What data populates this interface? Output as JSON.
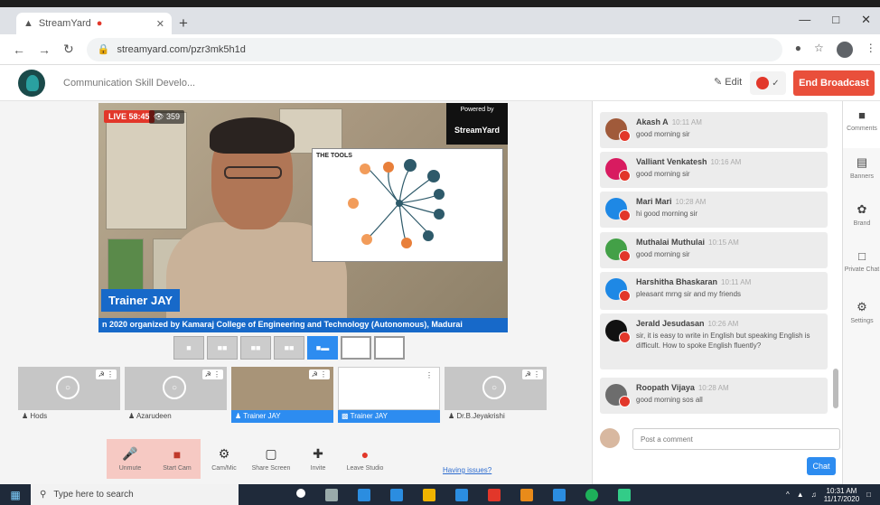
{
  "browser": {
    "tab_title": "StreamYard",
    "url": "streamyard.com/pzr3mk5h1d"
  },
  "app": {
    "title": "Communication Skill Develo...",
    "edit_label": "Edit",
    "end_broadcast_label": "End Broadcast"
  },
  "stage": {
    "live_label": "LIVE 58:45",
    "viewers": "359",
    "powered_by": "Powered by",
    "powered_brand": "StreamYard",
    "slide_title": "THE TOOLS",
    "name_banner": "Trainer JAY",
    "ticker": "n 2020 organized by Kamaraj College of Engineering and Technology (Autonomous), Madurai"
  },
  "participants": [
    {
      "label": "Hods",
      "type": "empty"
    },
    {
      "label": "Azarudeen",
      "type": "empty"
    },
    {
      "label": "Trainer JAY",
      "type": "camera"
    },
    {
      "label": "Trainer JAY",
      "type": "screen"
    },
    {
      "label": "Dr.B.Jeyakrishi",
      "type": "empty"
    }
  ],
  "controls": {
    "unmute": "Unmute",
    "start_cam": "Start Cam",
    "cam_mic": "Cam/Mic",
    "share_screen": "Share Screen",
    "invite": "Invite",
    "leave_studio": "Leave Studio",
    "help": "Having issues?"
  },
  "chat": {
    "messages": [
      {
        "name": "Akash A",
        "time": "10:11 AM",
        "text": "good morning sir",
        "color": "#a05a3a"
      },
      {
        "name": "Valliant Venkatesh",
        "time": "10:16 AM",
        "text": "good morning sir",
        "color": "#d81b60"
      },
      {
        "name": "Mari Mari",
        "time": "10:28 AM",
        "text": "hi good morning sir",
        "color": "#1e88e5"
      },
      {
        "name": "Muthalai Muthulai",
        "time": "10:15 AM",
        "text": "good morning sir",
        "color": "#43a047"
      },
      {
        "name": "Harshitha Bhaskaran",
        "time": "10:11 AM",
        "text": "pleasant mrng sir and my friends",
        "color": "#1e88e5"
      },
      {
        "name": "Jerald Jesudasan",
        "time": "10:26 AM",
        "text": "sir, it is easy to write in English but speaking English is difficult. How to spoke English fluently?",
        "color": "#111111"
      },
      {
        "name": "Roopath Vijaya",
        "time": "10:28 AM",
        "text": "good morning sos all",
        "color": "#6d6d6d"
      }
    ],
    "input_placeholder": "Post a comment",
    "send_label": "Chat"
  },
  "rail": {
    "comments": "Comments",
    "banners": "Banners",
    "brand": "Brand",
    "private_chat": "Private Chat",
    "settings": "Settings"
  },
  "taskbar": {
    "search_placeholder": "Type here to search",
    "time": "10:31 AM",
    "date": "11/17/2020"
  }
}
